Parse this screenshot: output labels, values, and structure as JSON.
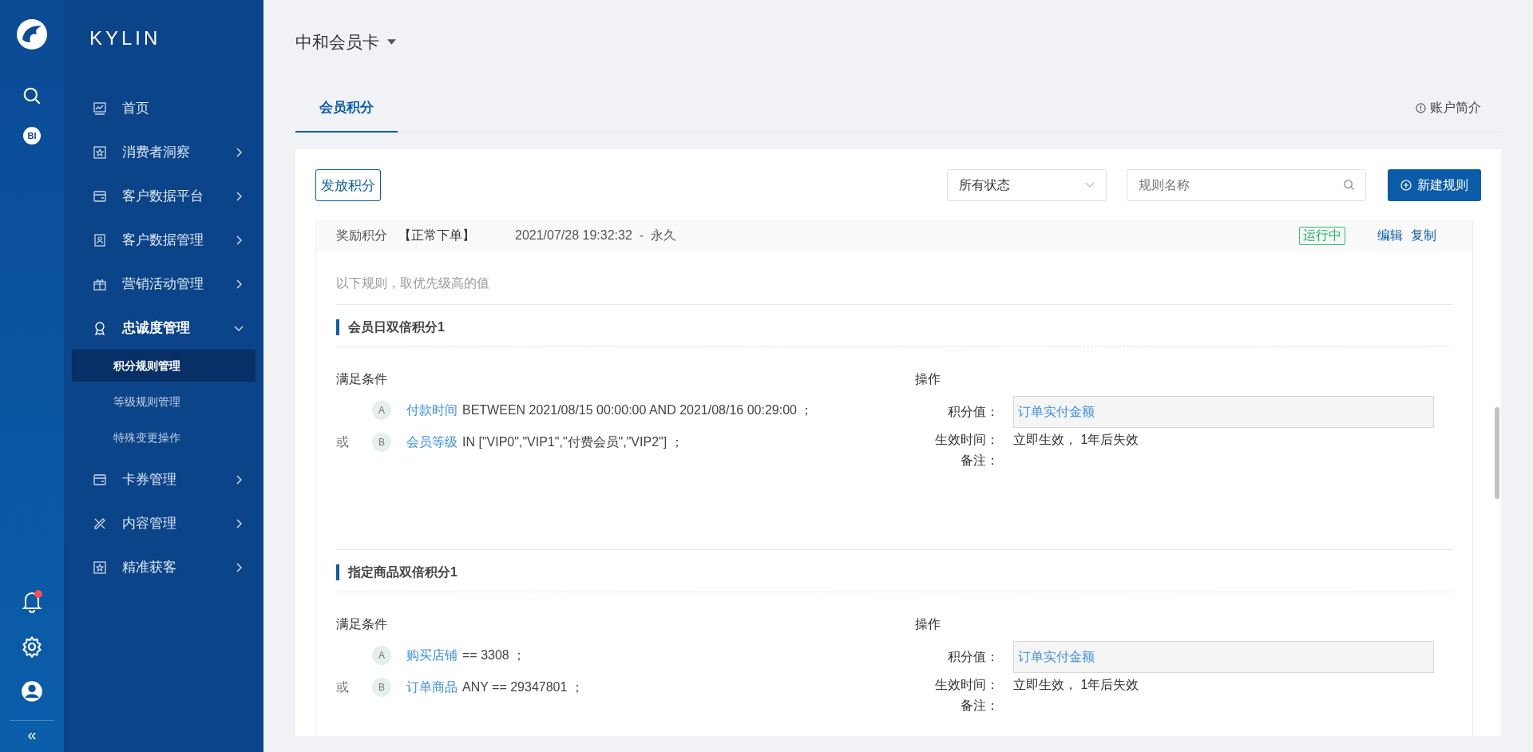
{
  "brand": {
    "name": "KYLIN",
    "bi_badge": "BI",
    "collapse": "«"
  },
  "nav": [
    {
      "label": "首页"
    },
    {
      "label": "消费者洞察",
      "expanded": false
    },
    {
      "label": "客户数据平台",
      "expanded": false
    },
    {
      "label": "客户数据管理",
      "expanded": false
    },
    {
      "label": "营销活动管理",
      "expanded": false
    },
    {
      "label": "忠诚度管理",
      "expanded": true,
      "children": [
        {
          "label": "积分规则管理",
          "selected": true
        },
        {
          "label": "等级规则管理",
          "selected": false
        },
        {
          "label": "特殊变更操作",
          "selected": false
        }
      ]
    },
    {
      "label": "卡券管理",
      "expanded": false
    },
    {
      "label": "内容管理",
      "expanded": false
    },
    {
      "label": "精准获客",
      "expanded": false
    }
  ],
  "header": {
    "account": "中和会员卡",
    "tabs": [
      {
        "label": "会员积分",
        "selected": true
      }
    ],
    "info_link": "账户简介"
  },
  "toolbar": {
    "grant_button": "发放积分",
    "status_filter": "所有状态",
    "search_placeholder": "规则名称",
    "new_button": "新建规则"
  },
  "rule_group": {
    "type": "奖励积分",
    "event": "【正常下单】",
    "period": "2021/07/28 19:32:32  -  永久",
    "status": "运行中",
    "actions": [
      "编辑",
      "复制"
    ],
    "note": "以下规则，取优先级高的值",
    "rules": [
      {
        "title": "会员日双倍积分1",
        "conditions_label": "满足条件",
        "conditions": [
          {
            "tag": "A",
            "field": "付款时间",
            "expr": "BETWEEN 2021/08/15 00:00:00 AND 2021/08/16 00:29:00 ；"
          },
          {
            "connector": "或",
            "tag": "B",
            "field": "会员等级",
            "expr": "IN [\"VIP0\",\"VIP1\",\"付费会员\",\"VIP2\"] ；"
          }
        ],
        "action_label": "操作",
        "fields": [
          {
            "kind": "box",
            "label": "积分值：",
            "value": "订单实付金额"
          },
          {
            "kind": "text",
            "label": "生效时间：",
            "value": "立即生效， 1年后失效"
          },
          {
            "kind": "text",
            "label": "备注："
          }
        ]
      },
      {
        "title": "指定商品双倍积分1",
        "conditions_label": "满足条件",
        "conditions": [
          {
            "tag": "A",
            "field": "购买店铺",
            "expr": "== 3308 ；"
          },
          {
            "connector": "或",
            "tag": "B",
            "field": "订单商品",
            "expr": "ANY == 29347801 ；"
          }
        ],
        "action_label": "操作",
        "fields": [
          {
            "kind": "box",
            "label": "积分值：",
            "value": "订单实付金额"
          },
          {
            "kind": "text",
            "label": "生效时间：",
            "value": "立即生效， 1年后失效"
          },
          {
            "kind": "text",
            "label": "备注："
          }
        ]
      }
    ]
  }
}
